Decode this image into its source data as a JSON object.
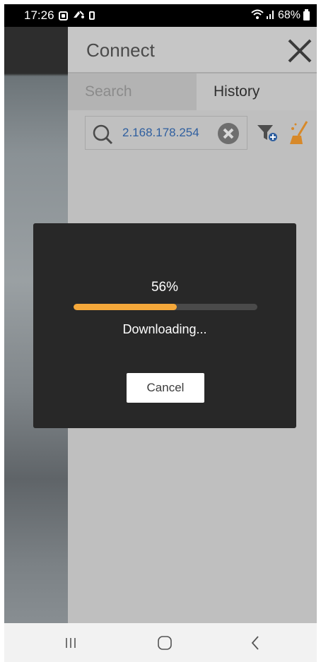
{
  "status_bar": {
    "time": "17:26",
    "battery": "68%",
    "left_icons": [
      "app-notification-icon",
      "wifi-calling-icon",
      "card-icon"
    ],
    "right_icons": [
      "wifi-icon",
      "signal-icon",
      "battery-icon"
    ]
  },
  "connect": {
    "title": "Connect",
    "tabs": [
      {
        "label": "Search",
        "active": false
      },
      {
        "label": "History",
        "active": true
      }
    ],
    "search": {
      "query": "2.168.178.254"
    }
  },
  "dialog": {
    "percent_label": "56%",
    "progress": 0.56,
    "status": "Downloading...",
    "cancel_label": "Cancel"
  },
  "nav_bar": {
    "buttons": [
      "recent-apps",
      "home",
      "back"
    ]
  },
  "colors": {
    "progress_fill": "#f5a83a",
    "progress_track": "#4a4a4a",
    "dialog_bg": "#282828",
    "query_text": "#2f5f9f",
    "broom_accent": "#d7892a"
  }
}
